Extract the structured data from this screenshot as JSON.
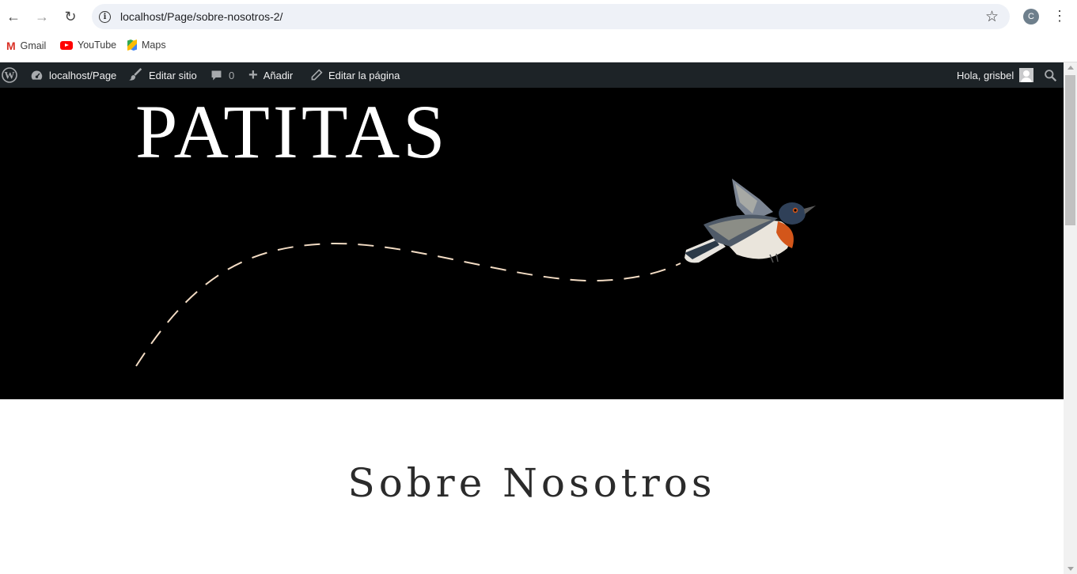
{
  "browser": {
    "url": "localhost/Page/sobre-nosotros-2/",
    "profile_initial": "C",
    "bookmarks": [
      {
        "label": "Gmail",
        "icon": "gmail-icon"
      },
      {
        "label": "YouTube",
        "icon": "youtube-icon"
      },
      {
        "label": "Maps",
        "icon": "maps-icon"
      }
    ]
  },
  "admin_bar": {
    "site_name": "localhost/Page",
    "edit_site": "Editar sitio",
    "comments_count": "0",
    "add_new": "Añadir",
    "edit_page": "Editar la página",
    "greeting": "Hola, grisbel"
  },
  "hero": {
    "site_title": "PATITAS",
    "background_color": "#000000",
    "path_color": "#f3dcc4"
  },
  "page": {
    "heading": "Sobre Nosotros"
  }
}
